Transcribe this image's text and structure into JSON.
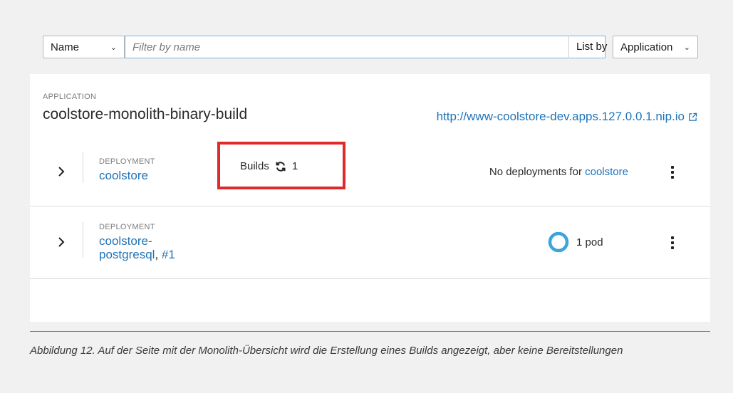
{
  "filter": {
    "type_select": "Name",
    "placeholder": "Filter by name",
    "list_by_label": "List by",
    "list_by_value": "Application"
  },
  "application": {
    "kicker": "APPLICATION",
    "name": "coolstore-monolith-binary-build",
    "url": "http://www-coolstore-dev.apps.127.0.0.1.nip.io"
  },
  "deployments": [
    {
      "kicker": "DEPLOYMENT",
      "name": "coolstore",
      "builds_label": "Builds",
      "builds_count": "1",
      "status_text": "No deployments for",
      "status_link": "coolstore"
    },
    {
      "kicker": "DEPLOYMENT",
      "name_line1": "coolstore-",
      "name_line2": "postgresql",
      "revision": "#1",
      "pods": "1 pod"
    }
  ],
  "caption": "Abbildung 12. Auf der Seite mit der Monolith-Übersicht wird die Erstellung eines Builds angezeigt, aber keine Bereitstellungen",
  "colors": {
    "link": "#1f73b7",
    "highlight_box": "#e02a2a",
    "pod_ring": "#39a5dc"
  },
  "icons": [
    "chevron-down-icon",
    "external-link-icon",
    "chevron-right-icon",
    "sync-icon",
    "kebab-icon",
    "pod-donut-icon"
  ]
}
